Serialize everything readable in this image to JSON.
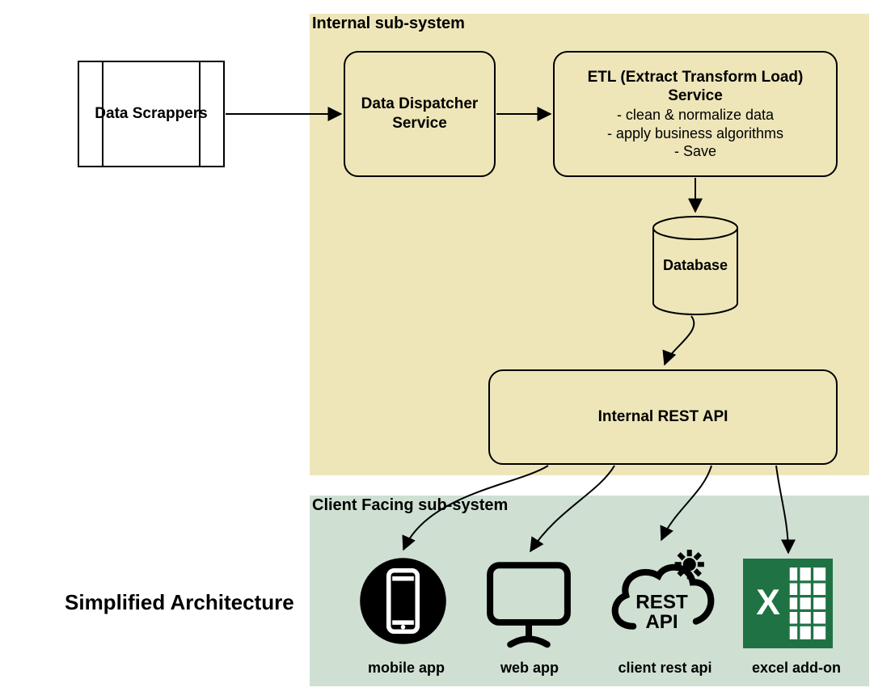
{
  "title": "Simplified Architecture",
  "regions": {
    "internal": {
      "label": "Internal sub-system",
      "bg": "#eee6b9"
    },
    "client": {
      "label": "Client Facing sub-system",
      "bg": "#cfe0d3"
    }
  },
  "nodes": {
    "scrapers": {
      "label": "Data Scrappers"
    },
    "dispatcher": {
      "label": "Data Dispatcher Service"
    },
    "etl": {
      "title": "ETL (Extract Transform Load) Service",
      "line1": "- clean & normalize data",
      "line2": "- apply business algorithms",
      "line3": "- Save"
    },
    "database": {
      "label": "Database"
    },
    "rest_api": {
      "label": "Internal REST API"
    }
  },
  "clients": {
    "mobile": {
      "label": "mobile app"
    },
    "web": {
      "label": "web app"
    },
    "rest": {
      "label": "client  rest api"
    },
    "excel": {
      "label": "excel add-on"
    }
  },
  "colors": {
    "excel_green": "#1f7244",
    "black": "#000000"
  }
}
